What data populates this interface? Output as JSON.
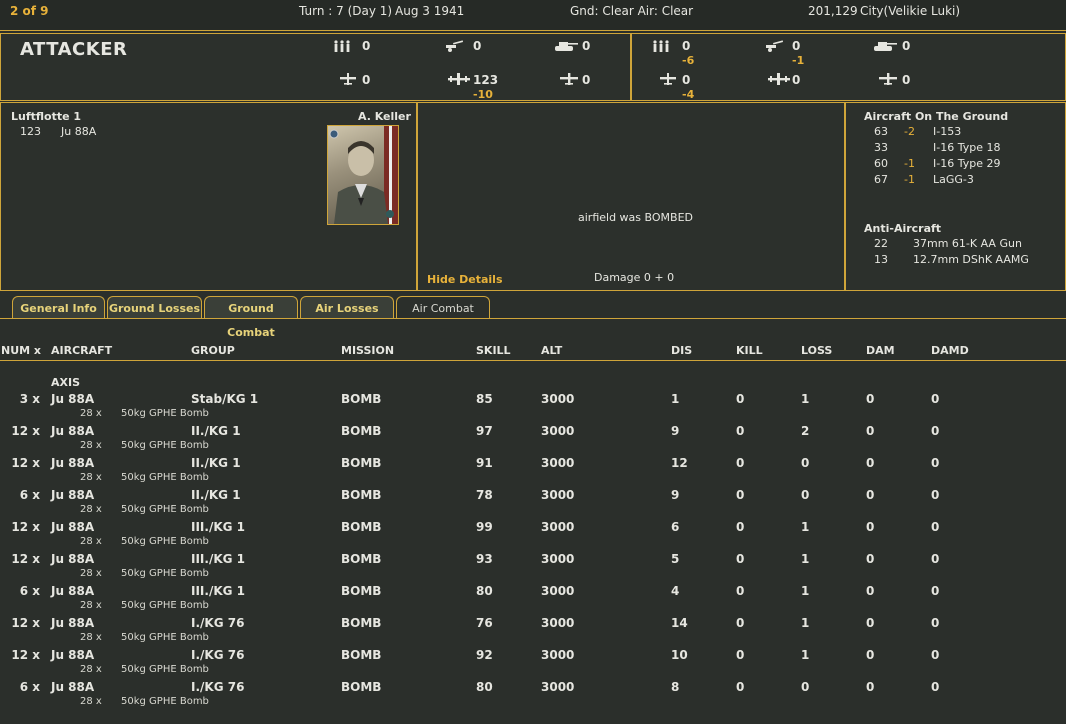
{
  "header": {
    "page": "2 of 9",
    "turn": "Turn : 7 (Day 1)",
    "date": "Aug 3 1941",
    "weather": "Gnd: Clear  Air: Clear",
    "coords": "201,129",
    "location": "City(Velikie Luki)"
  },
  "summary": {
    "title": "ATTACKER",
    "attacker": {
      "men": "0",
      "guns": "0",
      "tanks": "0",
      "fighters": "0",
      "bombers": "123",
      "bombers_loss": "-10",
      "other_air": "0"
    },
    "defender": {
      "men": "0",
      "men_loss": "-6",
      "guns": "0",
      "guns_loss": "-1",
      "tanks": "0",
      "fighters": "0",
      "fighters_loss": "-4",
      "bombers": "0",
      "other_air": "0"
    }
  },
  "attacker_panel": {
    "unit": "Luftflotte 1",
    "commander": "A. Keller",
    "count": "123",
    "aircraft": "Ju 88A"
  },
  "center_panel": {
    "message": "airfield was BOMBED",
    "hide_details": "Hide Details",
    "damage": "Damage  0 + 0"
  },
  "defender_panel": {
    "ground_title": "Aircraft On The Ground",
    "ground": [
      {
        "num": "63",
        "loss": "-2",
        "name": "I-153"
      },
      {
        "num": "33",
        "loss": "",
        "name": "I-16 Type 18"
      },
      {
        "num": "60",
        "loss": "-1",
        "name": "I-16 Type 29"
      },
      {
        "num": "67",
        "loss": "-1",
        "name": "LaGG-3"
      }
    ],
    "aa_title": "Anti-Aircraft",
    "aa": [
      {
        "num": "22",
        "name": "37mm 61-K AA Gun"
      },
      {
        "num": "13",
        "name": "12.7mm DShK AAMG"
      }
    ]
  },
  "tabs": [
    "General Info",
    "Ground Losses",
    "Ground Combat",
    "Air Losses",
    "Air Combat"
  ],
  "table": {
    "headers": [
      "NUM x",
      "AIRCRAFT",
      "GROUP",
      "MISSION",
      "SKILL",
      "ALT",
      "DIS",
      "KILL",
      "LOSS",
      "DAM",
      "DAMD"
    ],
    "side_label": "AXIS",
    "rows": [
      {
        "num": "3 x",
        "aircraft": "Ju 88A",
        "group": "Stab/KG 1",
        "mission": "BOMB",
        "skill": "85",
        "alt": "3000",
        "dis": "1",
        "kill": "0",
        "loss": "1",
        "dam": "0",
        "damd": "0",
        "wnum": "28 x",
        "weapon": "50kg GPHE Bomb"
      },
      {
        "num": "12 x",
        "aircraft": "Ju 88A",
        "group": "II./KG 1",
        "mission": "BOMB",
        "skill": "97",
        "alt": "3000",
        "dis": "9",
        "kill": "0",
        "loss": "2",
        "dam": "0",
        "damd": "0",
        "wnum": "28 x",
        "weapon": "50kg GPHE Bomb"
      },
      {
        "num": "12 x",
        "aircraft": "Ju 88A",
        "group": "II./KG 1",
        "mission": "BOMB",
        "skill": "91",
        "alt": "3000",
        "dis": "12",
        "kill": "0",
        "loss": "0",
        "dam": "0",
        "damd": "0",
        "wnum": "28 x",
        "weapon": "50kg GPHE Bomb"
      },
      {
        "num": "6 x",
        "aircraft": "Ju 88A",
        "group": "II./KG 1",
        "mission": "BOMB",
        "skill": "78",
        "alt": "3000",
        "dis": "9",
        "kill": "0",
        "loss": "0",
        "dam": "0",
        "damd": "0",
        "wnum": "28 x",
        "weapon": "50kg GPHE Bomb"
      },
      {
        "num": "12 x",
        "aircraft": "Ju 88A",
        "group": "III./KG 1",
        "mission": "BOMB",
        "skill": "99",
        "alt": "3000",
        "dis": "6",
        "kill": "0",
        "loss": "1",
        "dam": "0",
        "damd": "0",
        "wnum": "28 x",
        "weapon": "50kg GPHE Bomb"
      },
      {
        "num": "12 x",
        "aircraft": "Ju 88A",
        "group": "III./KG 1",
        "mission": "BOMB",
        "skill": "93",
        "alt": "3000",
        "dis": "5",
        "kill": "0",
        "loss": "1",
        "dam": "0",
        "damd": "0",
        "wnum": "28 x",
        "weapon": "50kg GPHE Bomb"
      },
      {
        "num": "6 x",
        "aircraft": "Ju 88A",
        "group": "III./KG 1",
        "mission": "BOMB",
        "skill": "80",
        "alt": "3000",
        "dis": "4",
        "kill": "0",
        "loss": "1",
        "dam": "0",
        "damd": "0",
        "wnum": "28 x",
        "weapon": "50kg GPHE Bomb"
      },
      {
        "num": "12 x",
        "aircraft": "Ju 88A",
        "group": "I./KG 76",
        "mission": "BOMB",
        "skill": "76",
        "alt": "3000",
        "dis": "14",
        "kill": "0",
        "loss": "1",
        "dam": "0",
        "damd": "0",
        "wnum": "28 x",
        "weapon": "50kg GPHE Bomb"
      },
      {
        "num": "12 x",
        "aircraft": "Ju 88A",
        "group": "I./KG 76",
        "mission": "BOMB",
        "skill": "92",
        "alt": "3000",
        "dis": "10",
        "kill": "0",
        "loss": "1",
        "dam": "0",
        "damd": "0",
        "wnum": "28 x",
        "weapon": "50kg GPHE Bomb"
      },
      {
        "num": "6 x",
        "aircraft": "Ju 88A",
        "group": "I./KG 76",
        "mission": "BOMB",
        "skill": "80",
        "alt": "3000",
        "dis": "8",
        "kill": "0",
        "loss": "0",
        "dam": "0",
        "damd": "0",
        "wnum": "28 x",
        "weapon": "50kg GPHE Bomb"
      }
    ]
  }
}
